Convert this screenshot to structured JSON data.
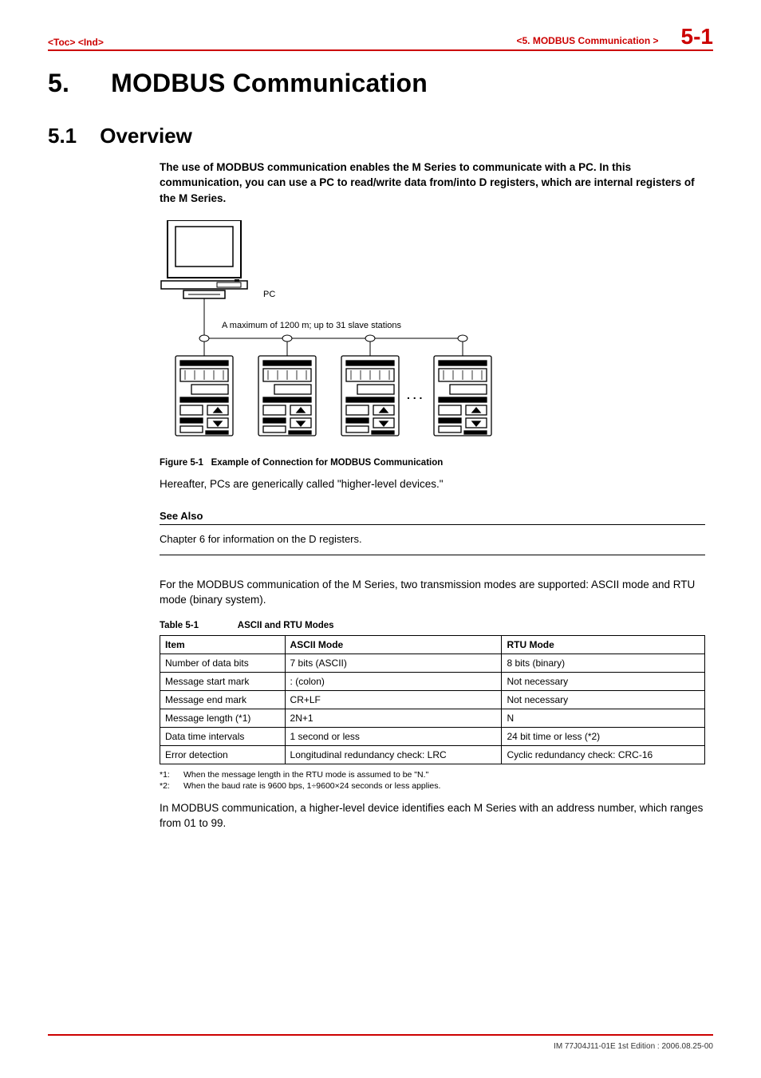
{
  "header": {
    "toc": "<Toc>",
    "ind": "<Ind>",
    "breadcrumb": "<5.  MODBUS Communication >",
    "page_num": "5-1"
  },
  "chapter": {
    "number": "5.",
    "title": "MODBUS Communication"
  },
  "section": {
    "number": "5.1",
    "title": "Overview"
  },
  "lead": "The use of MODBUS communication enables the M Series to communicate with a PC. In this communication, you can use a PC to read/write data from/into D registers, which are internal registers of the M Series.",
  "diagram": {
    "pc_label": "PC",
    "bus_line": "A maximum of 1200 m; up to 31 slave stations",
    "ellipsis": ". . .",
    "caption_label": "Figure 5-1",
    "caption_text": "Example of Connection for MODBUS Communication"
  },
  "after_fig": "Hereafter, PCs are generically called \"higher-level devices.\"",
  "see_also": {
    "heading": "See Also",
    "body": "Chapter 6 for information on the D registers."
  },
  "modes_intro": "For the MODBUS communication of the M Series, two transmission modes are supported: ASCII mode and RTU mode (binary system).",
  "table": {
    "caption_label": "Table 5-1",
    "caption_text": "ASCII and RTU Modes",
    "headers": [
      "Item",
      "ASCII Mode",
      "RTU Mode"
    ],
    "rows": [
      [
        "Number of data bits",
        "7 bits (ASCII)",
        "8 bits (binary)"
      ],
      [
        "Message start mark",
        ": (colon)",
        "Not necessary"
      ],
      [
        "Message end mark",
        "CR+LF",
        "Not necessary"
      ],
      [
        "Message length (*1)",
        "2N+1",
        "N"
      ],
      [
        "Data time intervals",
        "1 second or less",
        "24 bit time or less (*2)"
      ],
      [
        "Error detection",
        "Longitudinal redundancy check: LRC",
        "Cyclic redundancy check: CRC-16"
      ]
    ]
  },
  "footnotes": [
    {
      "mark": "*1:",
      "text": "When the message length in the RTU mode is assumed to be \"N.\""
    },
    {
      "mark": "*2:",
      "text": "When the baud rate is 9600 bps, 1÷9600×24 seconds or less applies."
    }
  ],
  "closing": "In MODBUS communication, a higher-level device identifies each M Series with an address number, which ranges from 01 to 99.",
  "footer": "IM 77J04J11-01E  1st Edition : 2006.08.25-00"
}
